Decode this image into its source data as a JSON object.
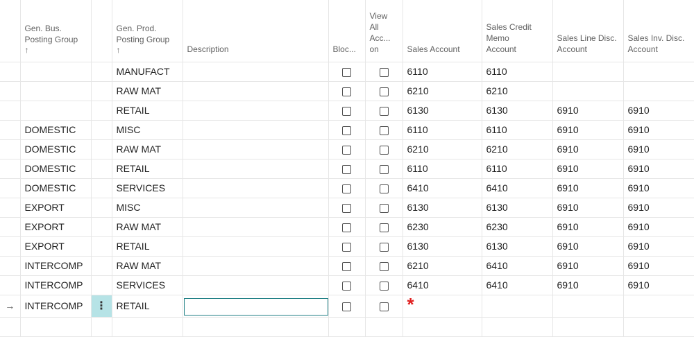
{
  "headers": {
    "bus_line1": "Gen. Bus.",
    "bus_line2": "Posting Group",
    "prod_line1": "Gen. Prod.",
    "prod_line2": "Posting Group",
    "sort_arrow": "↑",
    "description": "Description",
    "blocked": "Bloc...",
    "view_line1": "View",
    "view_line2": "All",
    "view_line3": "Acc...",
    "view_line4": "on",
    "sales_account": "Sales Account",
    "memo_line1": "Sales Credit",
    "memo_line2": "Memo",
    "memo_line3": "Account",
    "line_disc_line1": "Sales Line Disc.",
    "line_disc_line2": "Account",
    "inv_disc_line1": "Sales Inv. Disc.",
    "inv_disc_line2": "Account"
  },
  "rows": [
    {
      "bus": "",
      "prod": "MANUFACT",
      "blocked": false,
      "view_all": false,
      "sales": "6110",
      "memo": "6110",
      "line_disc": "",
      "inv_disc": ""
    },
    {
      "bus": "",
      "prod": "RAW MAT",
      "blocked": false,
      "view_all": false,
      "sales": "6210",
      "memo": "6210",
      "line_disc": "",
      "inv_disc": ""
    },
    {
      "bus": "",
      "prod": "RETAIL",
      "blocked": false,
      "view_all": false,
      "sales": "6130",
      "memo": "6130",
      "line_disc": "6910",
      "inv_disc": "6910"
    },
    {
      "bus": "DOMESTIC",
      "prod": "MISC",
      "blocked": false,
      "view_all": false,
      "sales": "6110",
      "memo": "6110",
      "line_disc": "6910",
      "inv_disc": "6910"
    },
    {
      "bus": "DOMESTIC",
      "prod": "RAW MAT",
      "blocked": false,
      "view_all": false,
      "sales": "6210",
      "memo": "6210",
      "line_disc": "6910",
      "inv_disc": "6910"
    },
    {
      "bus": "DOMESTIC",
      "prod": "RETAIL",
      "blocked": false,
      "view_all": false,
      "sales": "6110",
      "memo": "6110",
      "line_disc": "6910",
      "inv_disc": "6910"
    },
    {
      "bus": "DOMESTIC",
      "prod": "SERVICES",
      "blocked": false,
      "view_all": false,
      "sales": "6410",
      "memo": "6410",
      "line_disc": "6910",
      "inv_disc": "6910"
    },
    {
      "bus": "EXPORT",
      "prod": "MISC",
      "blocked": false,
      "view_all": false,
      "sales": "6130",
      "memo": "6130",
      "line_disc": "6910",
      "inv_disc": "6910"
    },
    {
      "bus": "EXPORT",
      "prod": "RAW MAT",
      "blocked": false,
      "view_all": false,
      "sales": "6230",
      "memo": "6230",
      "line_disc": "6910",
      "inv_disc": "6910"
    },
    {
      "bus": "EXPORT",
      "prod": "RETAIL",
      "blocked": false,
      "view_all": false,
      "sales": "6130",
      "memo": "6130",
      "line_disc": "6910",
      "inv_disc": "6910"
    },
    {
      "bus": "INTERCOMP",
      "prod": "RAW MAT",
      "blocked": false,
      "view_all": false,
      "sales": "6210",
      "memo": "6410",
      "line_disc": "6910",
      "inv_disc": "6910"
    },
    {
      "bus": "INTERCOMP",
      "prod": "SERVICES",
      "blocked": false,
      "view_all": false,
      "sales": "6410",
      "memo": "6410",
      "line_disc": "6910",
      "inv_disc": "6910"
    }
  ],
  "active_row": {
    "indicator": "→",
    "bus": "INTERCOMP",
    "menu": "⋮",
    "prod": "RETAIL",
    "description": "",
    "blocked": false,
    "view_all": false,
    "sales_required": "*"
  },
  "colors": {
    "focus_border": "#1f7f84",
    "active_menu_bg": "#b6e3e6",
    "required_marker": "#e02020"
  }
}
